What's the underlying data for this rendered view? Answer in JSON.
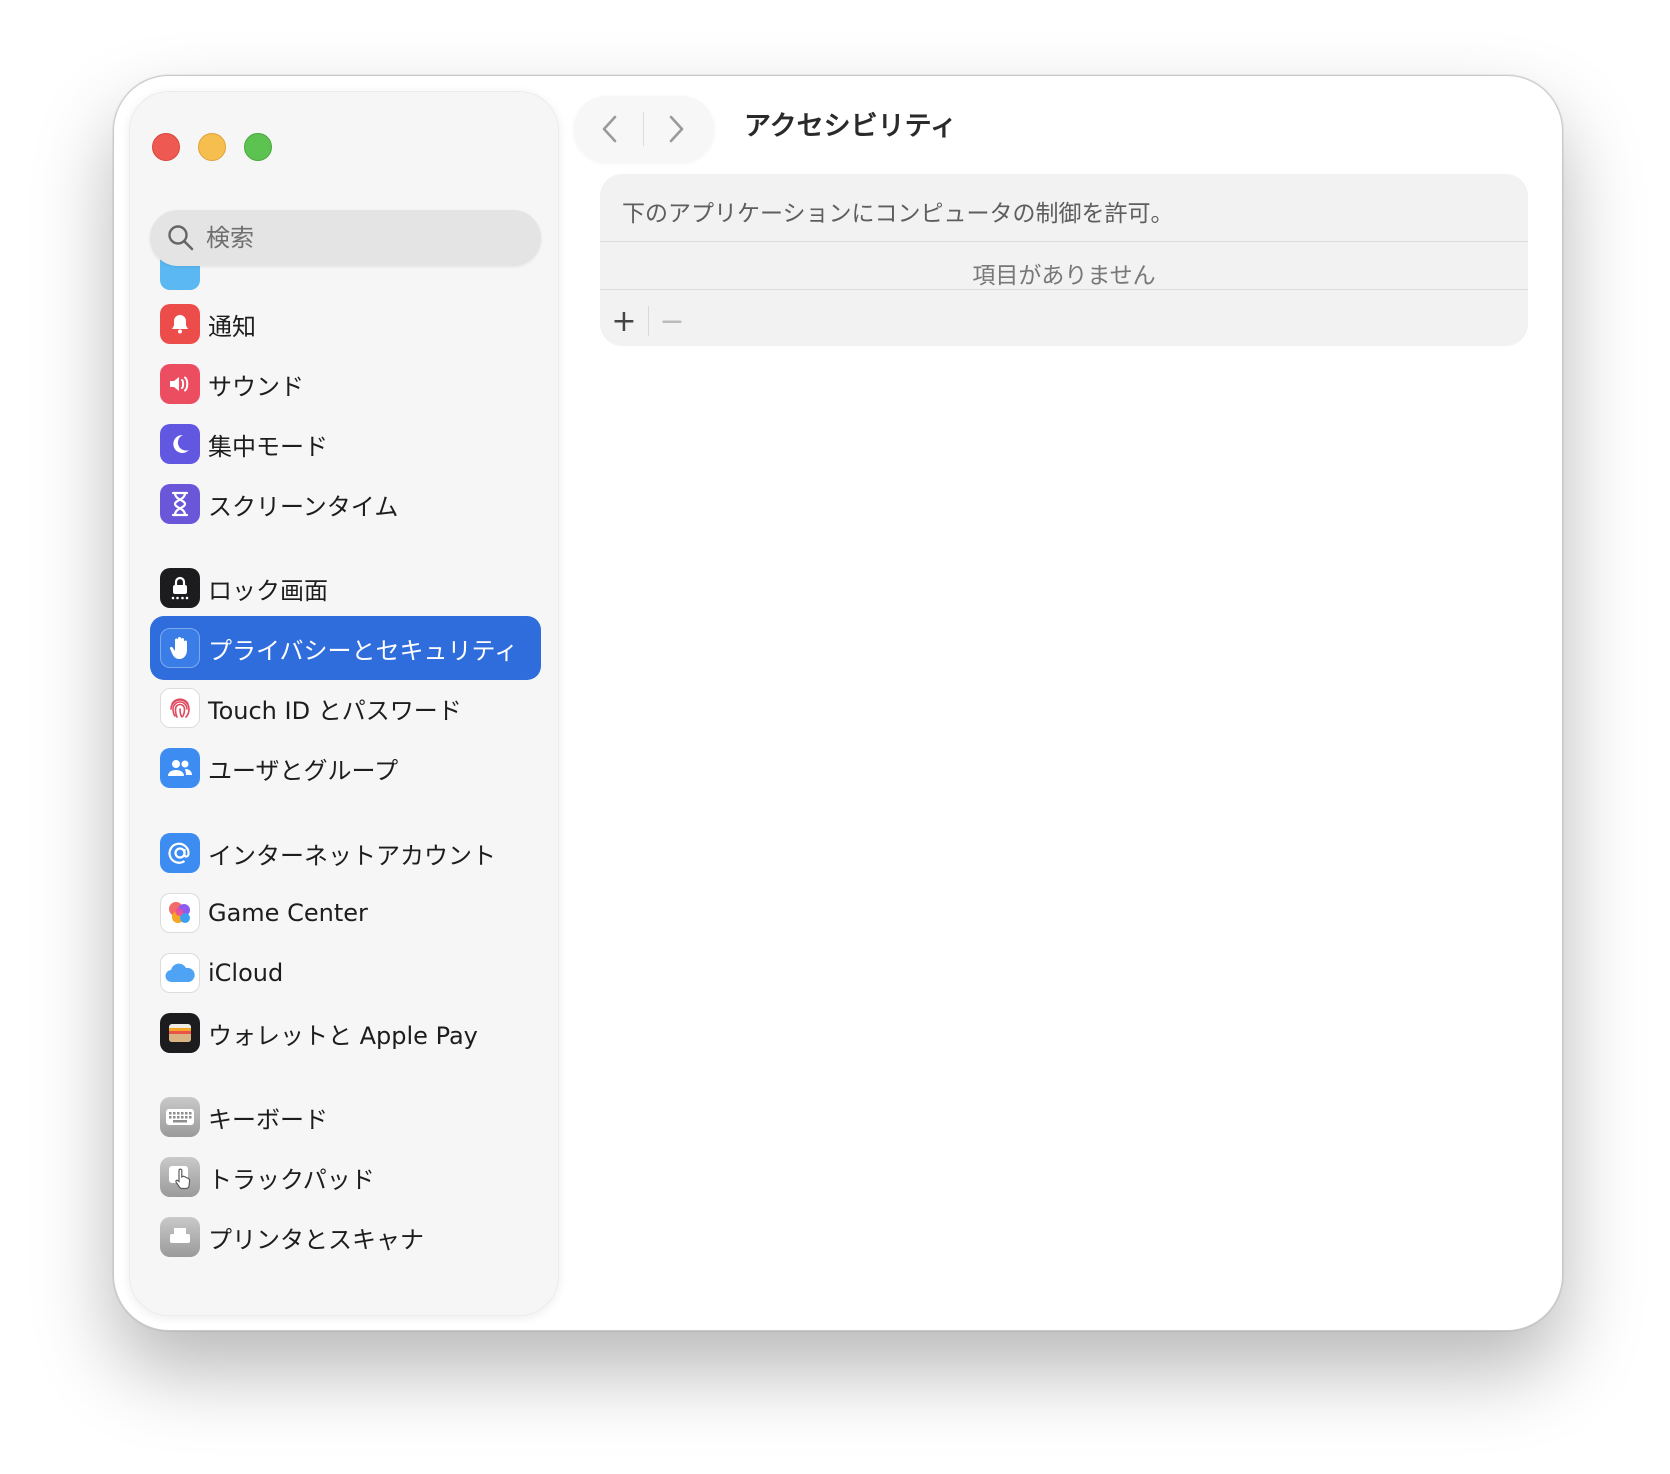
{
  "window": {
    "title": "アクセシビリティ"
  },
  "search": {
    "placeholder": "検索"
  },
  "sidebar": {
    "items": [
      {
        "label": "通知",
        "icon": "bell-icon",
        "color": "#ec4d4b"
      },
      {
        "label": "サウンド",
        "icon": "speaker-icon",
        "color": "#ec4d60"
      },
      {
        "label": "集中モード",
        "icon": "moon-icon",
        "color": "#6257e0"
      },
      {
        "label": "スクリーンタイム",
        "icon": "hourglass-icon",
        "color": "#6a56d8"
      },
      {
        "label": "ロック画面",
        "icon": "lock-icon",
        "color": "#1c1c1e"
      },
      {
        "label": "プライバシーとセキュリティ",
        "icon": "hand-icon",
        "color": "#3a7de6",
        "selected": true
      },
      {
        "label": "Touch ID とパスワード",
        "icon": "fingerprint-icon",
        "color": "#ffffff"
      },
      {
        "label": "ユーザとグループ",
        "icon": "users-icon",
        "color": "#3d8cf2"
      },
      {
        "label": "インターネットアカウント",
        "icon": "at-icon",
        "color": "#3d8cf2"
      },
      {
        "label": "Game Center",
        "icon": "game-center-icon",
        "color": "#ffffff"
      },
      {
        "label": "iCloud",
        "icon": "cloud-icon",
        "color": "#ffffff"
      },
      {
        "label": "ウォレットと Apple Pay",
        "icon": "wallet-icon",
        "color": "#1c1c1e"
      },
      {
        "label": "キーボード",
        "icon": "keyboard-icon",
        "color": "#9a9a9a"
      },
      {
        "label": "トラックパッド",
        "icon": "trackpad-icon",
        "color": "#9a9a9a"
      },
      {
        "label": "プリンタとスキャナ",
        "icon": "printer-icon",
        "color": "#9a9a9a"
      }
    ]
  },
  "panel": {
    "header": "下のアプリケーションにコンピュータの制御を許可。",
    "empty_text": "項目がありません",
    "add_label": "+",
    "remove_label": "−"
  },
  "colors": {
    "accent": "#2f6ddc",
    "traffic_close": "#ee5a52",
    "traffic_minimize": "#f5be4f",
    "traffic_zoom": "#5cc250"
  }
}
